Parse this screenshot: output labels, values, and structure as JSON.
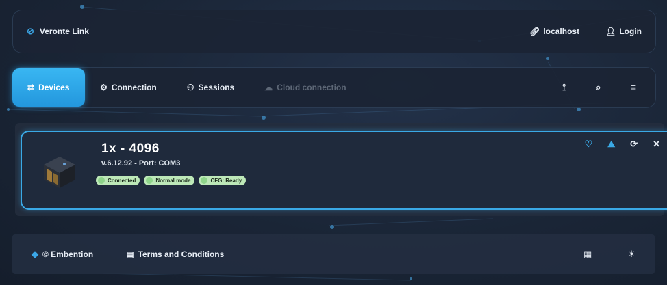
{
  "header": {
    "brand_label": "Veronte Link",
    "host_label": "localhost",
    "login_label": "Login"
  },
  "nav": {
    "tabs": [
      {
        "label": "Devices",
        "icon": "swap-icon",
        "active": true
      },
      {
        "label": "Connection",
        "icon": "gear-icon"
      },
      {
        "label": "Sessions",
        "icon": "sessions-icon"
      },
      {
        "label": "Cloud connection",
        "icon": "cloud-icon",
        "disabled": true
      }
    ],
    "right_icons": [
      "antenna-icon",
      "search-icon",
      "filter-icon"
    ]
  },
  "device": {
    "title": "1x - 4096",
    "subtitle": "v.6.12.92 - Port: COM3",
    "badges": [
      "Connected",
      "Normal mode",
      "CFG: Ready"
    ],
    "actions": [
      "heart-pulse-icon",
      "chart-icon",
      "refresh-icon",
      "close-icon"
    ]
  },
  "footer": {
    "company_label": "© Embention",
    "terms_label": "Terms and Conditions",
    "right_icons": [
      "grid-icon",
      "brightness-icon"
    ]
  },
  "colors": {
    "accent": "#39b6f2",
    "badge_bg": "#bde8b8",
    "card_border": "#3aa9e6"
  }
}
